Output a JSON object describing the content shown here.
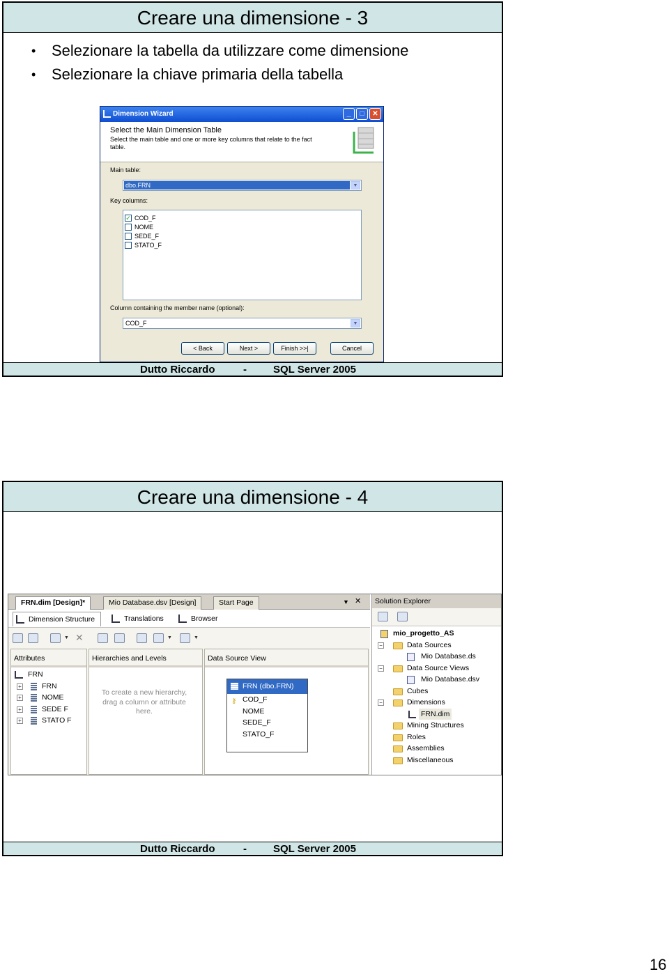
{
  "slide1": {
    "title": "Creare una dimensione - 3",
    "bullets": [
      "Selezionare la tabella da utilizzare come dimensione",
      "Selezionare la chiave primaria della tabella"
    ],
    "footer": {
      "author": "Dutto Riccardo",
      "dash": "-",
      "product": "SQL Server 2005"
    },
    "wizard": {
      "window_title": "Dimension Wizard",
      "header_title": "Select the Main Dimension Table",
      "header_desc": "Select the main table and one or more key columns that relate to the fact table.",
      "main_table_label": "Main table:",
      "main_table_value": "dbo.FRN",
      "key_columns_label": "Key columns:",
      "key_columns": [
        {
          "name": "COD_F",
          "checked": true
        },
        {
          "name": "NOME",
          "checked": false
        },
        {
          "name": "SEDE_F",
          "checked": false
        },
        {
          "name": "STATO_F",
          "checked": false
        }
      ],
      "member_name_label": "Column containing the member name (optional):",
      "member_name_value": "COD_F",
      "buttons": {
        "back": "< Back",
        "next": "Next >",
        "finish": "Finish >>|",
        "cancel": "Cancel"
      }
    }
  },
  "slide2": {
    "title": "Creare una dimensione - 4",
    "footer": {
      "author": "Dutto Riccardo",
      "dash": "-",
      "product": "SQL Server 2005"
    },
    "designer": {
      "doc_tabs": [
        "FRN.dim [Design]*",
        "Mio Database.dsv [Design]",
        "Start Page"
      ],
      "sub_tabs": [
        "Dimension Structure",
        "Translations",
        "Browser"
      ],
      "attributes_header": "Attributes",
      "attributes": [
        "FRN",
        "FRN",
        "NOME",
        "SEDE F",
        "STATO F"
      ],
      "hierarchies_header": "Hierarchies and Levels",
      "hierarchies_hint": "To create a new hierarchy, drag a column or attribute here.",
      "dsv_header": "Data Source View",
      "table": {
        "title": "FRN (dbo.FRN)",
        "columns": [
          "COD_F",
          "NOME",
          "SEDE_F",
          "STATO_F"
        ]
      },
      "solution_explorer": {
        "title": "Solution Explorer",
        "project": "mio_progetto_AS",
        "items": [
          "Data Sources",
          "Mio Database.ds",
          "Data Source Views",
          "Mio Database.dsv",
          "Cubes",
          "Dimensions",
          "FRN.dim",
          "Mining Structures",
          "Roles",
          "Assemblies",
          "Miscellaneous"
        ]
      }
    }
  },
  "page_number": "16"
}
